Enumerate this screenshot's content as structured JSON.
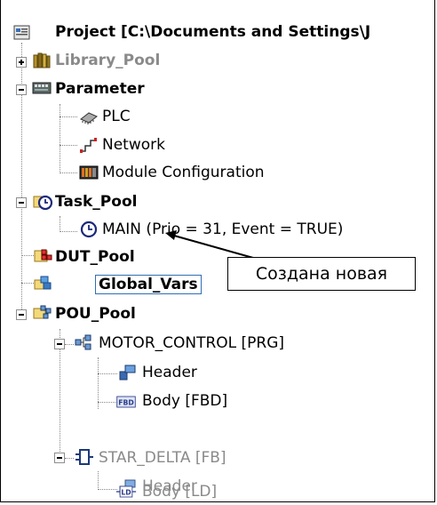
{
  "tree": {
    "root": "Project [C:\\Documents and Settings\\J",
    "items": [
      {
        "label": "Library_Pool"
      },
      {
        "label": "Parameter"
      },
      {
        "label": "PLC"
      },
      {
        "label": "Network"
      },
      {
        "label": "Module Configuration"
      },
      {
        "label": "Task_Pool"
      },
      {
        "label": "MAIN (Prio = 31, Event = TRUE)"
      },
      {
        "label": "DUT_Pool"
      },
      {
        "label": "Global_Vars"
      },
      {
        "label": "POU_Pool"
      },
      {
        "label": "MOTOR_CONTROL [PRG]"
      },
      {
        "label": "Header"
      },
      {
        "label": "Body [FBD]"
      },
      {
        "label": "STAR_DELTA [FB]"
      },
      {
        "label": "Header"
      },
      {
        "label": "Body [LD]"
      }
    ]
  },
  "callout": {
    "text": "Создана новая"
  },
  "icons": {
    "project": "project-icon",
    "library": "library-books-icon",
    "parameter": "parameter-board-icon",
    "plc": "plc-chip-icon",
    "network": "network-icon",
    "module": "module-configuration-icon",
    "task": "task-clock-icon",
    "dut": "dut-pool-icon",
    "global": "global-vars-icon",
    "pou": "pou-pool-icon",
    "header": "header-icon",
    "fbd": "fbd-icon",
    "ld": "ld-icon",
    "fb": "function-block-icon"
  }
}
